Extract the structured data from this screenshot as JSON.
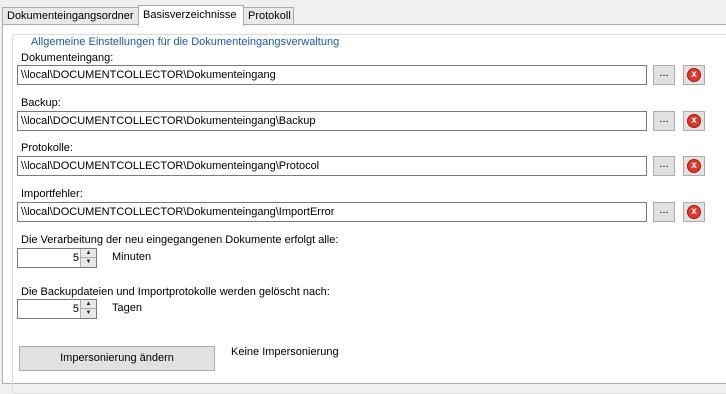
{
  "tabs": [
    {
      "label": "Dokumenteingangsordner",
      "active": false
    },
    {
      "label": "Basisverzeichnisse",
      "active": true
    },
    {
      "label": "Protokoll",
      "active": false
    }
  ],
  "group": {
    "title": "Allgemeine Einstellungen für die Dokumenteingangsverwaltung"
  },
  "paths": [
    {
      "label": "Dokumenteingang:",
      "value": "\\\\local\\DOCUMENTCOLLECTOR\\Dokumenteingang"
    },
    {
      "label": "Backup:",
      "value": "\\\\local\\DOCUMENTCOLLECTOR\\Dokumenteingang\\Backup"
    },
    {
      "label": "Protokolle:",
      "value": "\\\\local\\DOCUMENTCOLLECTOR\\Dokumenteingang\\Protocol"
    },
    {
      "label": "Importfehler:",
      "value": "\\\\local\\DOCUMENTCOLLECTOR\\Dokumenteingang\\ImportError"
    }
  ],
  "browse_label": "...",
  "clear_icon": "x",
  "processing": {
    "label": "Die Verarbeitung der neu eingegangenen Dokumente erfolgt alle:",
    "value": "5",
    "unit": "Minuten"
  },
  "retention": {
    "label": "Die Backupdateien und Importprotokolle werden gelöscht nach:",
    "value": "5",
    "unit": "Tagen"
  },
  "spin_up": "▲",
  "spin_down": "▼",
  "impersonation": {
    "button_label": "Impersonierung ändern",
    "status": "Keine Impersonierung"
  },
  "colors": {
    "group_title": "#1f5aa8",
    "clear_icon": "#e2372b"
  }
}
